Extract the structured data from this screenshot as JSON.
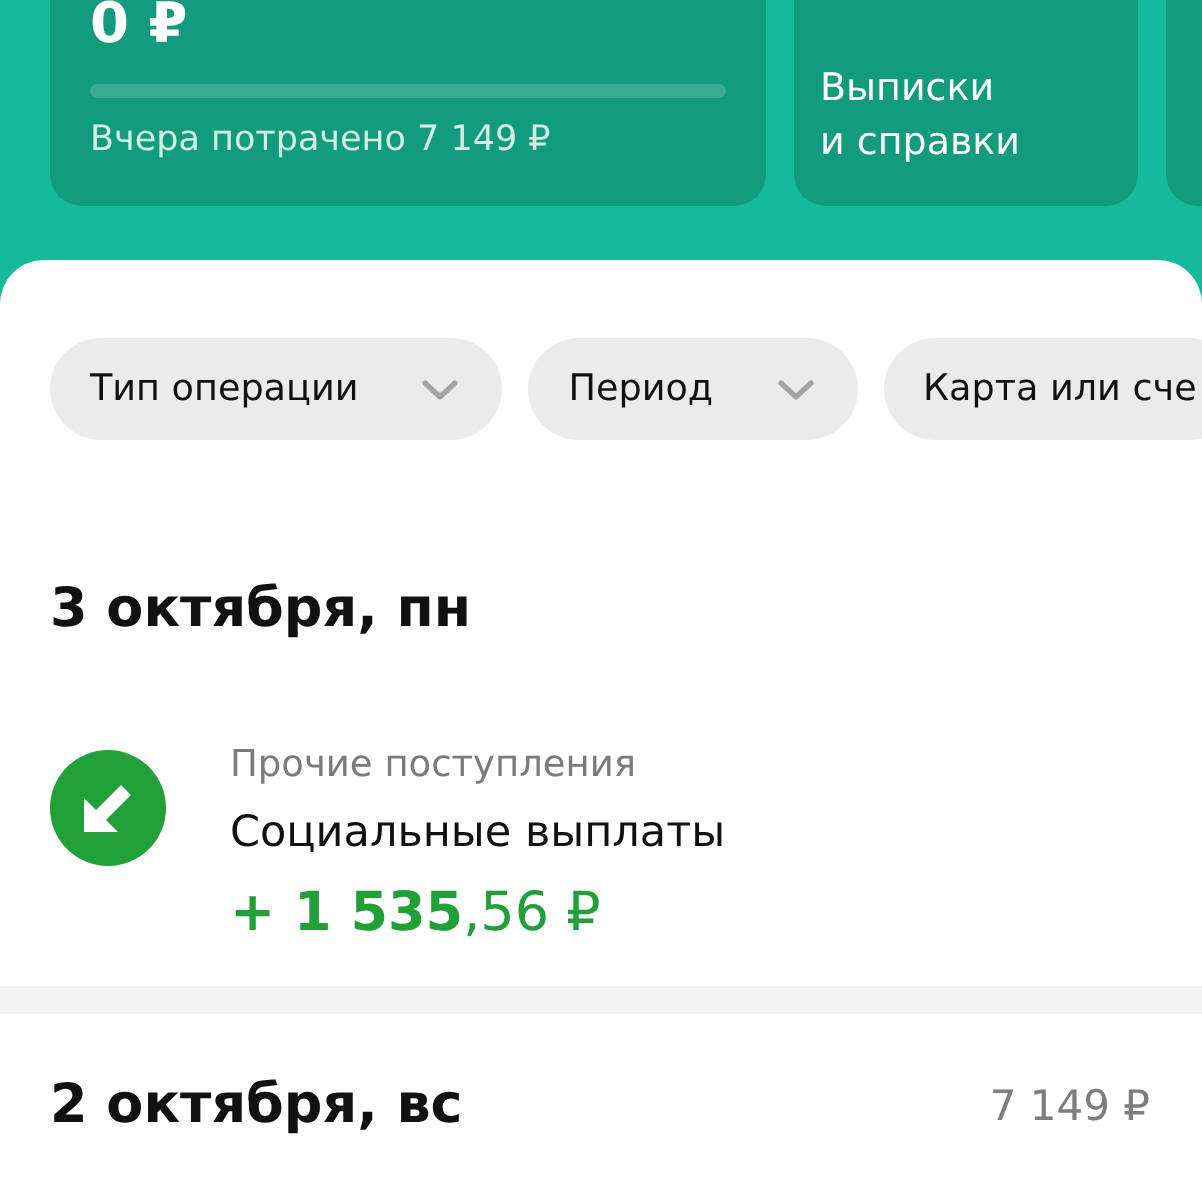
{
  "cards": [
    {
      "kind": "summary",
      "amount": "0 ₽",
      "progress": {
        "level": 0
      },
      "caption": "Вчера потрачено 7 149 ₽"
    },
    {
      "kind": "shortcut",
      "label": "Выписки\nи справки"
    },
    {
      "kind": "shortcut"
    }
  ],
  "filters": [
    {
      "label": "Тип операции",
      "chevron": true
    },
    {
      "label": "Период",
      "chevron": true
    },
    {
      "label": "Карта или сче",
      "chevron": false
    }
  ],
  "days": [
    {
      "date": "3 октября, пн",
      "operations": [
        {
          "kind": "incoming",
          "category": "Прочие поступления",
          "title": "Социальные выплаты",
          "amount": "**+ 1 535**,56 ₽"
        }
      ]
    },
    {
      "date": "2 октября, вс",
      "total": "7 149 ₽"
    }
  ]
}
